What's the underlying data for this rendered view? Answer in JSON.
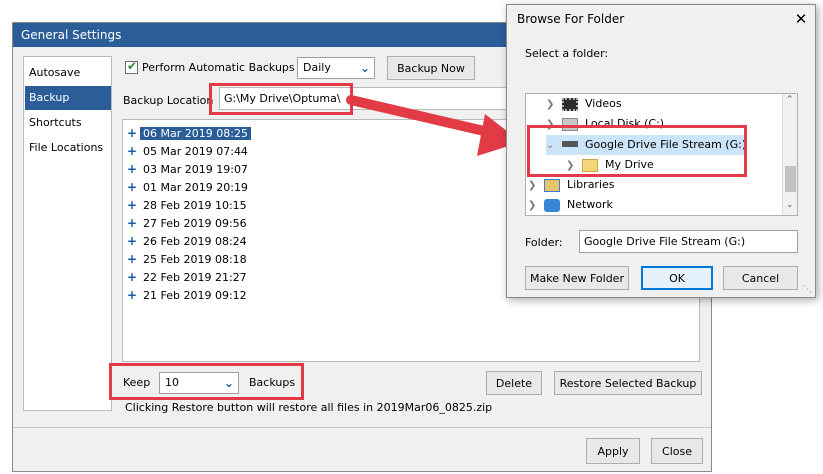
{
  "general_settings": {
    "title": "General Settings",
    "nav": [
      "Autosave",
      "Backup",
      "Shortcuts",
      "File Locations"
    ],
    "nav_selected": "Backup",
    "auto_backup_label": "Perform Automatic Backups",
    "auto_backup_checked": true,
    "frequency": "Daily",
    "backup_now_label": "Backup Now",
    "backup_location_label": "Backup Location",
    "backup_location_value": "G:\\My Drive\\Optuma\\",
    "backups": [
      "06 Mar 2019 08:25",
      "05 Mar 2019 07:44",
      "03 Mar 2019 19:07",
      "01 Mar 2019 20:19",
      "28 Feb 2019 10:15",
      "27 Feb 2019 09:56",
      "26 Feb 2019 08:24",
      "25 Feb 2019 08:18",
      "22 Feb 2019 21:27",
      "21 Feb 2019 09:12"
    ],
    "selected_backup": "06 Mar 2019 08:25",
    "keep_label": "Keep",
    "keep_value": "10",
    "backups_label": "Backups",
    "delete_label": "Delete",
    "restore_label": "Restore Selected Backup",
    "hint": "Clicking Restore button will restore all files in 2019Mar06_0825.zip",
    "apply_label": "Apply",
    "close_label": "Close"
  },
  "browse_dialog": {
    "title": "Browse For Folder",
    "close_glyph": "✕",
    "prompt": "Select a folder:",
    "tree": [
      {
        "label": "Videos",
        "icon": "video-folder-icon"
      },
      {
        "label": "Local Disk (C:)",
        "icon": "disk-icon"
      },
      {
        "label": "Google Drive File Stream (G:)",
        "icon": "drive-icon",
        "expanded": true,
        "highlighted": true
      },
      {
        "label": "My Drive",
        "icon": "folder-icon"
      },
      {
        "label": "Libraries",
        "icon": "libraries-icon"
      },
      {
        "label": "Network",
        "icon": "network-icon"
      }
    ],
    "folder_label": "Folder:",
    "folder_value": "Google Drive File Stream (G:)",
    "make_new_folder_label": "Make New Folder",
    "ok_label": "OK",
    "cancel_label": "Cancel"
  },
  "colors": {
    "accent": "#2b5e99",
    "annotation": "#e23b45"
  }
}
